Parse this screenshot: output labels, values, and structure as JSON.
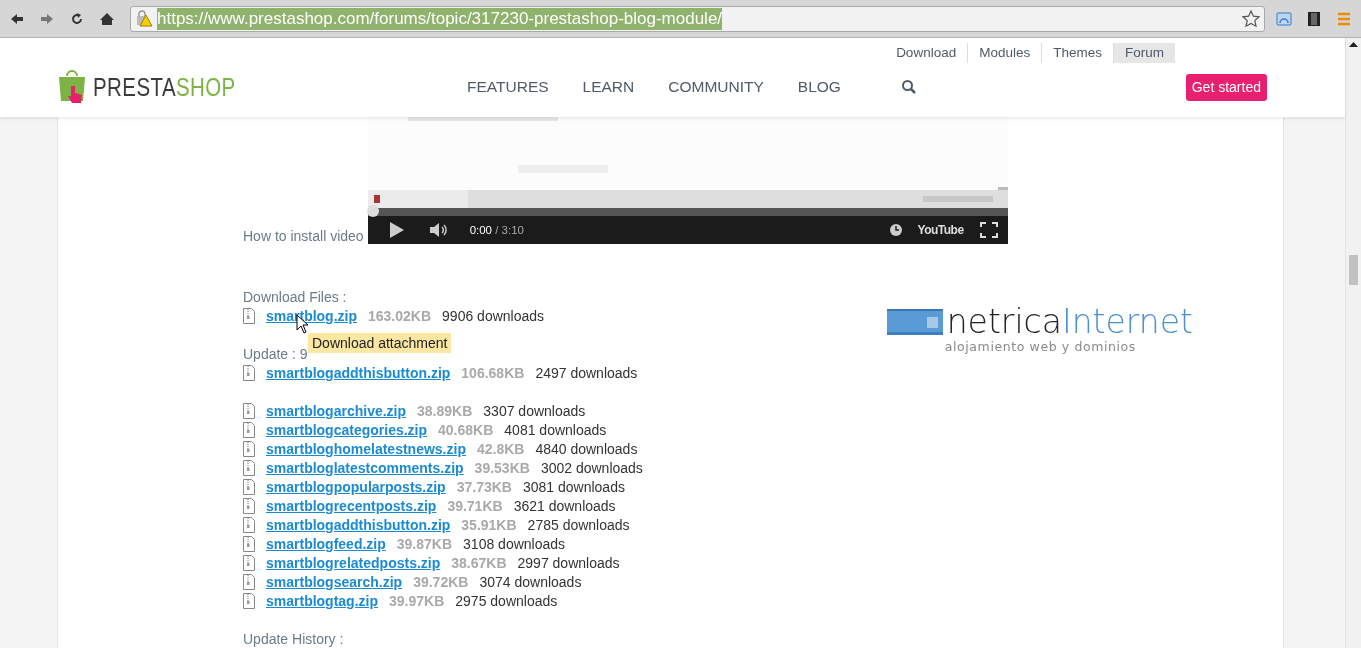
{
  "browser": {
    "url": "https://www.prestashop.com/forums/topic/317230-prestashop-blog-module/"
  },
  "header": {
    "logo": {
      "left": "PRESTA",
      "right": "SHOP"
    },
    "top_links": [
      {
        "label": "Download",
        "selected": false
      },
      {
        "label": "Modules",
        "selected": false
      },
      {
        "label": "Themes",
        "selected": false
      },
      {
        "label": "Forum",
        "selected": true
      }
    ],
    "nav": [
      "FEATURES",
      "LEARN",
      "COMMUNITY",
      "BLOG"
    ],
    "cta": "Get started"
  },
  "post": {
    "video_label": "How to install video",
    "video": {
      "kind": "picture",
      "time": "0:00",
      "duration": "/ 3:10",
      "logo": "YouTube",
      "level": 0
    },
    "sections": [
      {
        "heading": "Download Files :",
        "files": [
          {
            "name": "smartblog.zip",
            "size": "163.02KB",
            "downloads": "9906 downloads"
          }
        ]
      },
      {
        "heading": "Update : 9",
        "files": [
          {
            "name": "smartblogaddthisbutton.zip",
            "size": "106.68KB",
            "downloads": "2497 downloads"
          }
        ]
      },
      {
        "files": [
          {
            "name": "smartblogarchive.zip",
            "size": "38.89KB",
            "downloads": "3307 downloads"
          },
          {
            "name": "smartblogcategories.zip",
            "size": "40.68KB",
            "downloads": "4081 downloads"
          },
          {
            "name": "smartbloghomelatestnews.zip",
            "size": "42.8KB",
            "downloads": "4840 downloads"
          },
          {
            "name": "smartbloglatestcomments.zip",
            "size": "39.53KB",
            "downloads": "3002 downloads"
          },
          {
            "name": "smartblogpopularposts.zip",
            "size": "37.73KB",
            "downloads": "3081 downloads"
          },
          {
            "name": "smartblogrecentposts.zip",
            "size": "39.71KB",
            "downloads": "3621 downloads"
          },
          {
            "name": "smartblogaddthisbutton.zip",
            "size": "35.91KB",
            "downloads": "2785 downloads"
          },
          {
            "name": "smartblogfeed.zip",
            "size": "39.87KB",
            "downloads": "3108 downloads"
          },
          {
            "name": "smartblogrelatedposts.zip",
            "size": "38.67KB",
            "downloads": "2997 downloads"
          },
          {
            "name": "smartblogsearch.zip",
            "size": "39.72KB",
            "downloads": "3074 downloads"
          },
          {
            "name": "smartblogtag.zip",
            "size": "39.97KB",
            "downloads": "2975 downloads"
          }
        ]
      },
      {
        "heading": "Update History :"
      }
    ],
    "tooltip": "Download attachment",
    "ad": {
      "brand_left": "netrica",
      "brand_right": "Internet",
      "tagline": "alojamiento web y dominios"
    }
  }
}
